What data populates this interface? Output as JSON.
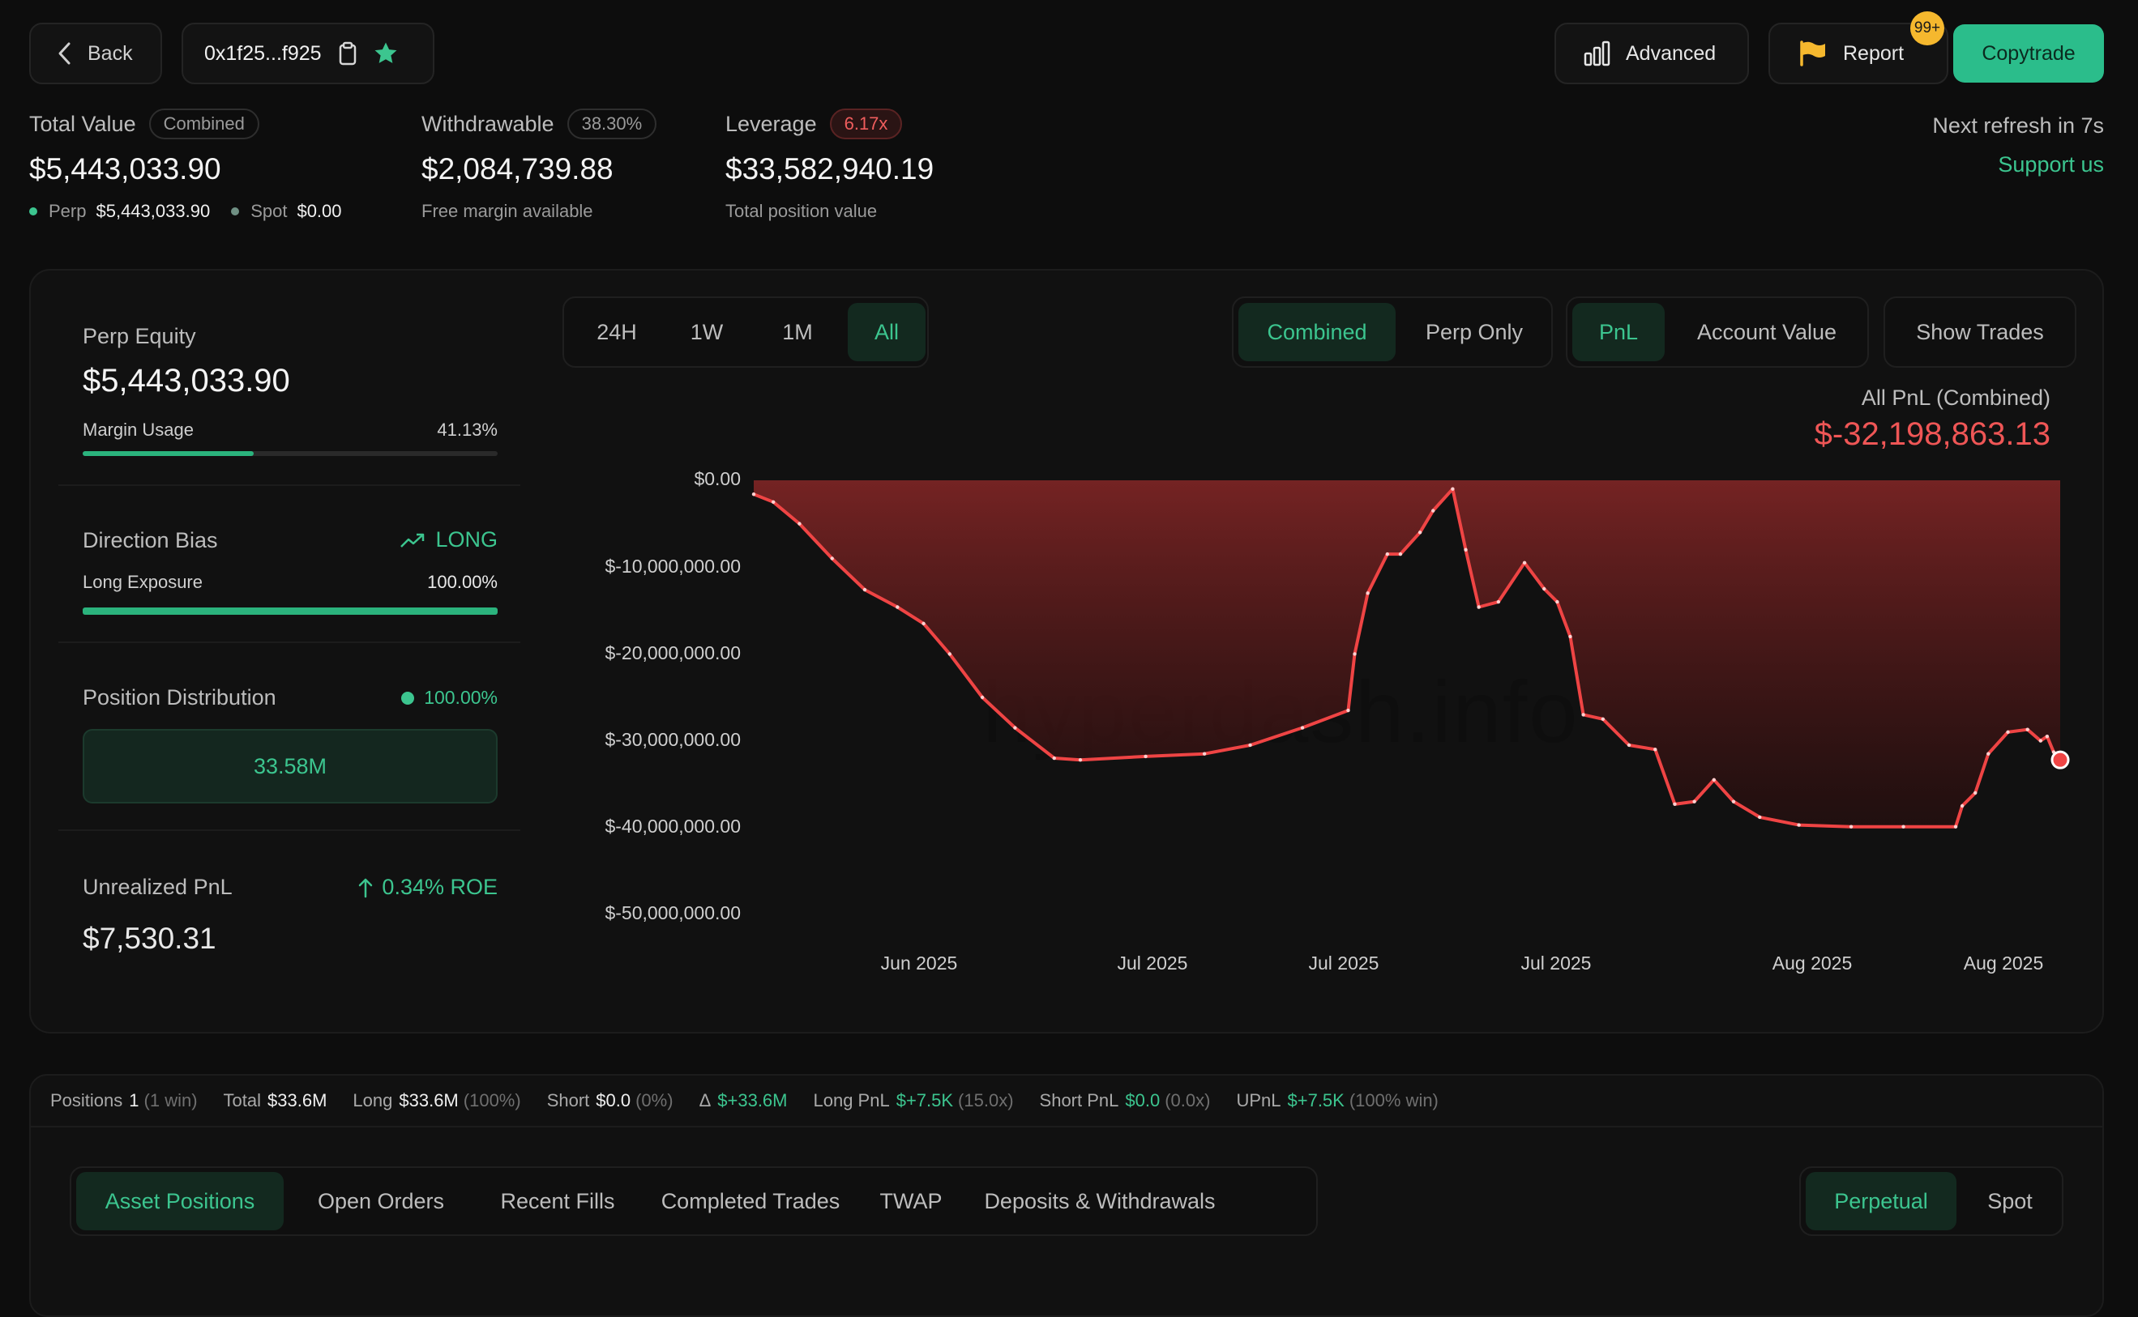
{
  "header": {
    "back_label": "Back",
    "address": "0x1f25...f925",
    "advanced_label": "Advanced",
    "report_label": "Report",
    "report_badge": "99+",
    "copytrade_label": "Copytrade"
  },
  "summary": {
    "total_value": {
      "label": "Total Value",
      "tag": "Combined",
      "value": "$5,443,033.90",
      "perp_label": "Perp",
      "perp_value": "$5,443,033.90",
      "spot_label": "Spot",
      "spot_value": "$0.00"
    },
    "withdrawable": {
      "label": "Withdrawable",
      "tag": "38.30%",
      "value": "$2,084,739.88",
      "sub": "Free margin available"
    },
    "leverage": {
      "label": "Leverage",
      "tag": "6.17x",
      "value": "$33,582,940.19",
      "sub": "Total position value"
    },
    "next_refresh": "Next refresh in 7s",
    "support_label": "Support us"
  },
  "left_panel": {
    "perp_equity_label": "Perp Equity",
    "perp_equity_value": "$5,443,033.90",
    "margin_usage_label": "Margin Usage",
    "margin_usage_value": "41.13%",
    "margin_usage_fraction": 0.4113,
    "direction_bias_label": "Direction Bias",
    "direction_bias_value": "LONG",
    "long_exposure_label": "Long Exposure",
    "long_exposure_value": "100.00%",
    "long_exposure_fraction": 1.0,
    "position_distribution_label": "Position Distribution",
    "position_distribution_value": "100.00%",
    "position_distribution_amount": "33.58M",
    "unrealized_pnl_label": "Unrealized PnL",
    "unrealized_pnl_roe": "0.34% ROE",
    "unrealized_pnl_value": "$7,530.31"
  },
  "chart_controls": {
    "ranges": [
      "24H",
      "1W",
      "1M",
      "All"
    ],
    "active_range": "All",
    "modes": [
      "Combined",
      "Perp Only"
    ],
    "active_mode": "Combined",
    "metrics": [
      "PnL",
      "Account Value"
    ],
    "active_metric": "PnL",
    "show_trades_label": "Show Trades"
  },
  "chart_header": {
    "label": "All PnL (Combined)",
    "value": "$-32,198,863.13"
  },
  "watermark": "hyperdash.info",
  "chart_data": {
    "type": "area",
    "y_ticks": [
      "$0.00",
      "$-10,000,000.00",
      "$-20,000,000.00",
      "$-30,000,000.00",
      "$-40,000,000.00",
      "$-50,000,000.00"
    ],
    "x_ticks": [
      "Jun 2025",
      "Jul 2025",
      "Jul 2025",
      "Jul 2025",
      "Aug 2025",
      "Aug 2025"
    ],
    "ylim": [
      -50000000,
      0
    ],
    "xlim": [
      0,
      1
    ],
    "line_color": "#ef4444",
    "fill_color": "#7a2424",
    "points": [
      [
        0.0,
        -1.6
      ],
      [
        0.015,
        -2.5
      ],
      [
        0.035,
        -5.0
      ],
      [
        0.06,
        -9.0
      ],
      [
        0.085,
        -12.6
      ],
      [
        0.11,
        -14.6
      ],
      [
        0.13,
        -16.5
      ],
      [
        0.15,
        -20.0
      ],
      [
        0.175,
        -25.0
      ],
      [
        0.2,
        -28.5
      ],
      [
        0.23,
        -32.0
      ],
      [
        0.25,
        -32.2
      ],
      [
        0.3,
        -31.8
      ],
      [
        0.345,
        -31.5
      ],
      [
        0.38,
        -30.5
      ],
      [
        0.42,
        -28.5
      ],
      [
        0.455,
        -26.5
      ],
      [
        0.46,
        -20.0
      ],
      [
        0.47,
        -13.0
      ],
      [
        0.485,
        -8.5
      ],
      [
        0.495,
        -8.5
      ],
      [
        0.51,
        -6.0
      ],
      [
        0.52,
        -3.5
      ],
      [
        0.535,
        -1.0
      ],
      [
        0.545,
        -8.0
      ],
      [
        0.555,
        -14.6
      ],
      [
        0.57,
        -14.0
      ],
      [
        0.59,
        -9.5
      ],
      [
        0.605,
        -12.5
      ],
      [
        0.615,
        -14.0
      ],
      [
        0.625,
        -18.0
      ],
      [
        0.635,
        -27.0
      ],
      [
        0.65,
        -27.5
      ],
      [
        0.67,
        -30.5
      ],
      [
        0.69,
        -31.0
      ],
      [
        0.705,
        -37.3
      ],
      [
        0.72,
        -37.0
      ],
      [
        0.735,
        -34.5
      ],
      [
        0.75,
        -37.0
      ],
      [
        0.77,
        -38.8
      ],
      [
        0.8,
        -39.7
      ],
      [
        0.84,
        -39.9
      ],
      [
        0.88,
        -39.9
      ],
      [
        0.92,
        -39.9
      ],
      [
        0.925,
        -37.5
      ],
      [
        0.935,
        -36.0
      ],
      [
        0.945,
        -31.5
      ],
      [
        0.96,
        -29.0
      ],
      [
        0.975,
        -28.7
      ],
      [
        0.985,
        -30.0
      ],
      [
        0.99,
        -29.5
      ],
      [
        0.995,
        -31.3
      ],
      [
        1.0,
        -32.2
      ]
    ],
    "point_value_unit": "millions USD"
  },
  "stats_bar": {
    "positions_label": "Positions",
    "positions_value": "1",
    "positions_detail": "(1 win)",
    "total_label": "Total",
    "total_value": "$33.6M",
    "long_label": "Long",
    "long_value": "$33.6M",
    "long_detail": "(100%)",
    "short_label": "Short",
    "short_value": "$0.0",
    "short_detail": "(0%)",
    "delta_label": "Δ",
    "delta_value": "$+33.6M",
    "long_pnl_label": "Long PnL",
    "long_pnl_value": "$+7.5K",
    "long_pnl_detail": "(15.0x)",
    "short_pnl_label": "Short PnL",
    "short_pnl_value": "$0.0",
    "short_pnl_detail": "(0.0x)",
    "upnl_label": "UPnL",
    "upnl_value": "$+7.5K",
    "upnl_detail": "(100% win)"
  },
  "bottom_tabs": {
    "tabs": [
      "Asset Positions",
      "Open Orders",
      "Recent Fills",
      "Completed Trades",
      "TWAP",
      "Deposits & Withdrawals"
    ],
    "active_tab": "Asset Positions",
    "market_types": [
      "Perpetual",
      "Spot"
    ],
    "active_market": "Perpetual"
  }
}
